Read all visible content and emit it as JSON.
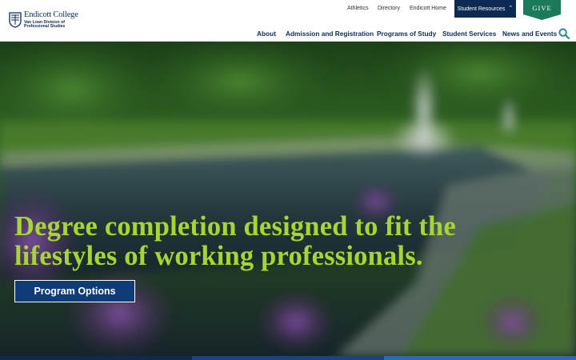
{
  "brand": {
    "name": "Endicott College",
    "sub_line1": "Van Loan Division of",
    "sub_line2": "Professional Studies"
  },
  "utility_nav": {
    "athletics": "Athletics",
    "directory": "Directory",
    "home": "Endicott Home",
    "student_resources": "Student Resources",
    "give": "GIVE"
  },
  "main_nav": {
    "about": "About",
    "admission": "Admission and Registration",
    "programs": "Programs of Study",
    "services": "Student Services",
    "news": "News and Events"
  },
  "hero": {
    "heading_line1": "Degree completion designed to fit the",
    "heading_line2": "lifestyles of working professionals.",
    "cta": "Program Options"
  },
  "icons": {
    "search": "search-icon",
    "caret": "chevron-up-icon",
    "seal": "college-seal-icon"
  },
  "colors": {
    "navy": "#0b2d5a",
    "give_green": "#1b7a5a",
    "heading_green": "#a5d631",
    "cta_blue": "#0d3c77",
    "search_teal": "#2a8a8a"
  }
}
